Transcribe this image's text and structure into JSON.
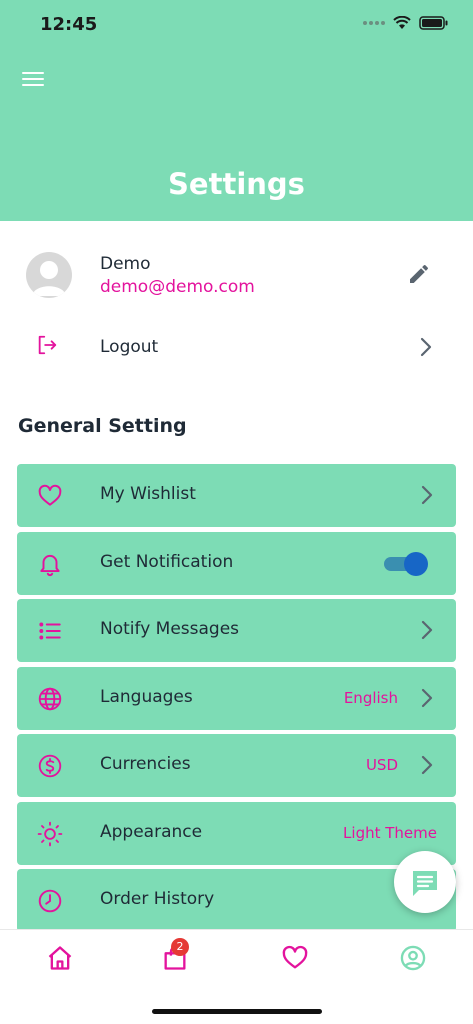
{
  "status_bar": {
    "time": "12:45"
  },
  "header": {
    "title": "Settings"
  },
  "profile": {
    "name": "Demo",
    "email": "demo@demo.com"
  },
  "logout": {
    "label": "Logout"
  },
  "section": {
    "title": "General Setting"
  },
  "settings": [
    {
      "label": "My Wishlist",
      "icon": "heart-icon"
    },
    {
      "label": "Get Notification",
      "icon": "bell-icon",
      "toggle_on": true
    },
    {
      "label": "Notify Messages",
      "icon": "list-icon"
    },
    {
      "label": "Languages",
      "icon": "globe-icon",
      "value": "English"
    },
    {
      "label": "Currencies",
      "icon": "dollar-icon",
      "value": "USD"
    },
    {
      "label": "Appearance",
      "icon": "sun-icon",
      "value": "Light Theme"
    },
    {
      "label": "Order History",
      "icon": "clock-icon"
    }
  ],
  "tabbar": {
    "cart_badge": "2"
  },
  "colors": {
    "accent": "#7ddcb5",
    "highlight": "#e3139d",
    "toggle": "#1766c6"
  }
}
